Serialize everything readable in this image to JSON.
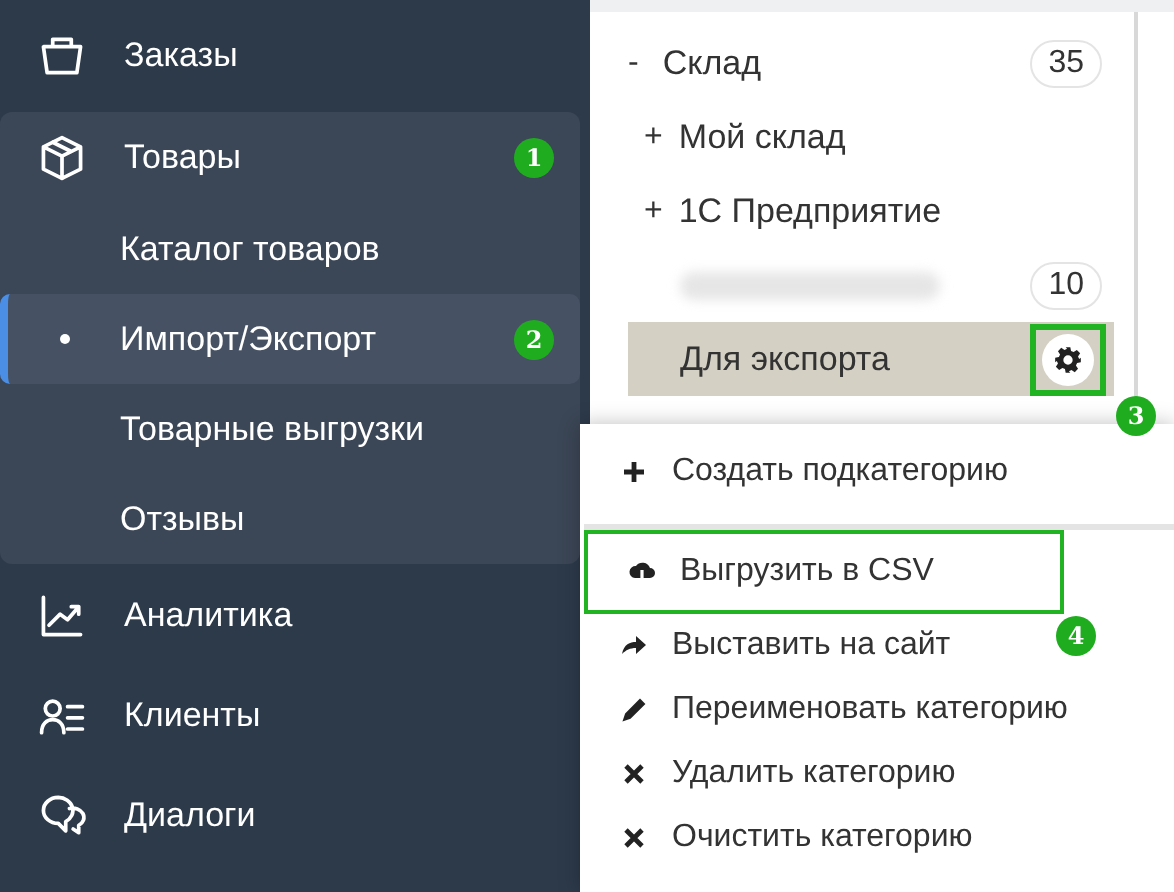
{
  "sidebar": {
    "items": [
      {
        "label": "Заказы",
        "expanded": false
      },
      {
        "label": "Товары",
        "expanded": true,
        "badge": "1",
        "children": [
          {
            "label": "Каталог товаров",
            "selected": false
          },
          {
            "label": "Импорт/Экспорт",
            "selected": true,
            "badge": "2"
          },
          {
            "label": "Товарные выгрузки",
            "selected": false
          },
          {
            "label": "Отзывы",
            "selected": false
          }
        ]
      },
      {
        "label": "Аналитика",
        "expanded": false
      },
      {
        "label": "Клиенты",
        "expanded": false
      },
      {
        "label": "Диалоги",
        "expanded": false
      }
    ]
  },
  "category_tree": [
    {
      "kind": "category",
      "toggle": "-",
      "label": "Склад",
      "count": "35",
      "expanded": true,
      "selected": false,
      "children": [
        {
          "kind": "category",
          "toggle": "+",
          "label": "Мой склад",
          "expanded": false,
          "selected": false
        },
        {
          "kind": "category",
          "toggle": "+",
          "label": "1С Предприятие",
          "expanded": false,
          "selected": false
        },
        {
          "kind": "redacted",
          "count": "10",
          "selected": false
        },
        {
          "kind": "category",
          "label": "Для экспорта",
          "selected": true,
          "settings_badge": "3"
        }
      ]
    }
  ],
  "context_menu": {
    "sections": [
      {
        "items": [
          {
            "label": "Создать подкатегорию",
            "highlighted": false
          }
        ]
      },
      {
        "items": [
          {
            "label": "Выгрузить в CSV",
            "highlighted": true,
            "badge": "4"
          },
          {
            "label": "Выставить на сайт",
            "highlighted": false
          },
          {
            "label": "Переименовать категорию",
            "highlighted": false
          },
          {
            "label": "Удалить категорию",
            "highlighted": false
          },
          {
            "label": "Очистить категорию",
            "highlighted": false
          }
        ]
      }
    ]
  }
}
